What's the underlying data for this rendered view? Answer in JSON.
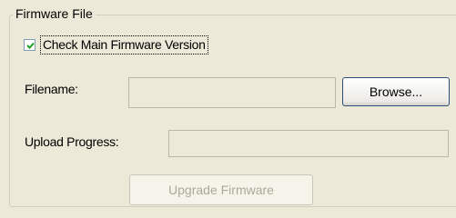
{
  "group": {
    "title": "Firmware File"
  },
  "check_main_firmware": {
    "label": "Check Main Firmware Version",
    "checked": true
  },
  "filename": {
    "label": "Filename:",
    "value": "",
    "browse_label": "Browse..."
  },
  "upload_progress": {
    "label": "Upload Progress:",
    "progress": 0
  },
  "upgrade_button": {
    "label": "Upgrade Firmware",
    "enabled": false
  }
}
